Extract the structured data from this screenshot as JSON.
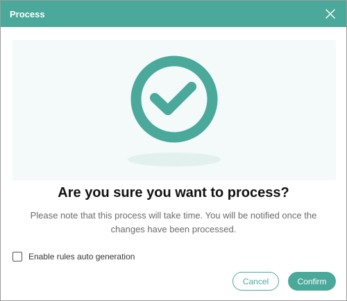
{
  "window": {
    "title": "Process",
    "close_icon": "close-icon"
  },
  "hero": {
    "icon": "check-circle-icon",
    "colors": {
      "accent": "#4aa99a",
      "background": "#f3faf9",
      "shadow": "#e2f1ee"
    }
  },
  "content": {
    "heading": "Are you sure you want to process?",
    "note": "Please note that this process will take time. You will be notified once the changes have been processed."
  },
  "options": {
    "auto_rules_label": "Enable rules auto generation",
    "auto_rules_checked": false
  },
  "actions": {
    "cancel_label": "Cancel",
    "confirm_label": "Confirm"
  },
  "colors": {
    "primary": "#4aa99a",
    "text": "#111111",
    "muted_text": "#6a6a6a"
  }
}
